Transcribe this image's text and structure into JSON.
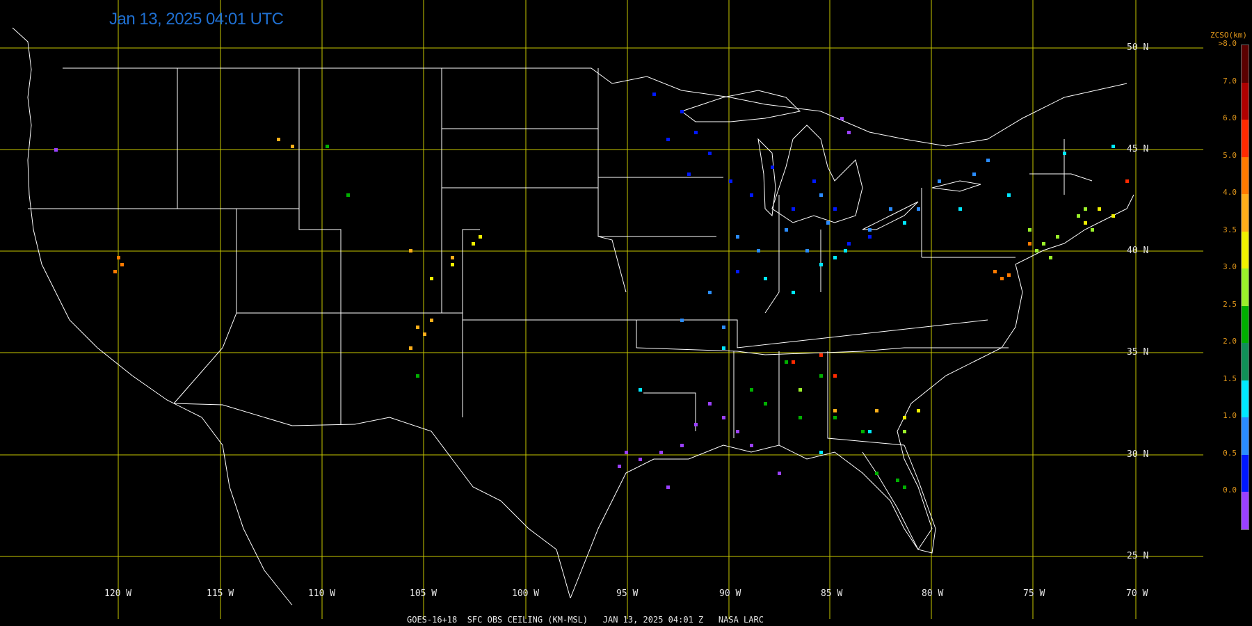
{
  "title": "Jan 13, 2025 04:01 UTC",
  "caption": "GOES-16+18  SFC OBS CEILING (KM-MSL)   JAN 13, 2025 04:01 Z   NASA LARC",
  "lat_lines": [
    {
      "label": "50 N"
    },
    {
      "label": "45 N"
    },
    {
      "label": "40 N"
    },
    {
      "label": "35 N"
    },
    {
      "label": "30 N"
    },
    {
      "label": "25 N"
    }
  ],
  "lon_lines": [
    {
      "label": "120 W"
    },
    {
      "label": "115 W"
    },
    {
      "label": "110 W"
    },
    {
      "label": "105 W"
    },
    {
      "label": "100 W"
    },
    {
      "label": "95 W"
    },
    {
      "label": "90 W"
    },
    {
      "label": "85 W"
    },
    {
      "label": "80 W"
    },
    {
      "label": "75 W"
    },
    {
      "label": "70 W"
    }
  ],
  "legend": {
    "title": "ZCSO(km)",
    "top_label": ">8.0",
    "ticks": [
      "7.0",
      "6.0",
      "5.0",
      "4.0",
      "3.5",
      "3.0",
      "2.5",
      "2.0",
      "1.5",
      "1.0",
      "0.5",
      "0.0"
    ],
    "colors": [
      "#5a0000",
      "#b00000",
      "#ff2a00",
      "#ff7a00",
      "#ffae1a",
      "#f0f000",
      "#9af02a",
      "#00b000",
      "#109058",
      "#00e8ff",
      "#2a8cff",
      "#0018ff",
      "#9a40ff"
    ]
  },
  "colors": {
    "grid": "#c8c800",
    "boundary": "#ffffff",
    "background": "#000000"
  },
  "station_groups": [
    {
      "name": "ceiling-0-1km",
      "color": "#0018ff",
      "points": [
        [
          940,
          135
        ],
        [
          980,
          160
        ],
        [
          1000,
          190
        ],
        [
          1020,
          220
        ],
        [
          1050,
          260
        ],
        [
          1080,
          280
        ],
        [
          1110,
          240
        ],
        [
          1140,
          300
        ],
        [
          1170,
          260
        ],
        [
          1200,
          300
        ],
        [
          1220,
          350
        ],
        [
          1060,
          390
        ],
        [
          1250,
          340
        ],
        [
          960,
          200
        ],
        [
          990,
          250
        ]
      ]
    },
    {
      "name": "ceiling-1-1.5km",
      "color": "#2a8cff",
      "points": [
        [
          1130,
          330
        ],
        [
          1160,
          360
        ],
        [
          1190,
          320
        ],
        [
          1250,
          330
        ],
        [
          1280,
          300
        ],
        [
          1320,
          300
        ],
        [
          1350,
          260
        ],
        [
          1400,
          250
        ],
        [
          1420,
          230
        ],
        [
          1060,
          340
        ],
        [
          1090,
          360
        ],
        [
          1020,
          420
        ],
        [
          980,
          460
        ],
        [
          1040,
          470
        ],
        [
          1180,
          280
        ]
      ]
    },
    {
      "name": "ceiling-1.5-2km",
      "color": "#00e8ff",
      "points": [
        [
          1100,
          400
        ],
        [
          1140,
          420
        ],
        [
          1180,
          380
        ],
        [
          1200,
          370
        ],
        [
          1215,
          360
        ],
        [
          1380,
          300
        ],
        [
          1450,
          280
        ],
        [
          1530,
          220
        ],
        [
          1600,
          210
        ],
        [
          1040,
          500
        ],
        [
          920,
          560
        ],
        [
          1180,
          650
        ],
        [
          1250,
          620
        ],
        [
          1300,
          320
        ]
      ]
    },
    {
      "name": "ceiling-2-3km",
      "color": "#00b000",
      "points": [
        [
          1080,
          560
        ],
        [
          1100,
          580
        ],
        [
          1150,
          600
        ],
        [
          1200,
          600
        ],
        [
          1240,
          620
        ],
        [
          1260,
          680
        ],
        [
          1290,
          690
        ],
        [
          1300,
          700
        ],
        [
          1130,
          520
        ],
        [
          1180,
          540
        ],
        [
          600,
          540
        ],
        [
          470,
          210
        ],
        [
          500,
          280
        ]
      ]
    },
    {
      "name": "ceiling-3-3.5km",
      "color": "#9af02a",
      "points": [
        [
          1480,
          330
        ],
        [
          1490,
          360
        ],
        [
          1500,
          350
        ],
        [
          1510,
          370
        ],
        [
          1520,
          340
        ],
        [
          1550,
          310
        ],
        [
          1560,
          300
        ],
        [
          1570,
          330
        ],
        [
          1150,
          560
        ],
        [
          1300,
          620
        ]
      ]
    },
    {
      "name": "ceiling-3.5-4km",
      "color": "#f0f000",
      "points": [
        [
          650,
          380
        ],
        [
          620,
          400
        ],
        [
          680,
          350
        ],
        [
          690,
          340
        ],
        [
          1580,
          300
        ],
        [
          1600,
          310
        ],
        [
          1560,
          320
        ],
        [
          1300,
          600
        ],
        [
          1320,
          590
        ]
      ]
    },
    {
      "name": "ceiling-4-5km",
      "color": "#ffae1a",
      "points": [
        [
          620,
          460
        ],
        [
          600,
          470
        ],
        [
          590,
          500
        ],
        [
          610,
          480
        ],
        [
          590,
          360
        ],
        [
          650,
          370
        ],
        [
          1200,
          590
        ],
        [
          1260,
          590
        ],
        [
          400,
          200
        ],
        [
          420,
          210
        ]
      ]
    },
    {
      "name": "ceiling-5-6km",
      "color": "#ff7a00",
      "points": [
        [
          170,
          370
        ],
        [
          175,
          380
        ],
        [
          165,
          390
        ],
        [
          1430,
          390
        ],
        [
          1440,
          400
        ],
        [
          1450,
          395
        ],
        [
          1480,
          350
        ]
      ]
    },
    {
      "name": "ceiling-6-7km",
      "color": "#ff2a00",
      "points": [
        [
          1140,
          520
        ],
        [
          1200,
          540
        ],
        [
          1180,
          510
        ],
        [
          1620,
          260
        ]
      ]
    },
    {
      "name": "ceiling-below-0.5km",
      "color": "#9a40ff",
      "points": [
        [
          900,
          650
        ],
        [
          920,
          660
        ],
        [
          950,
          650
        ],
        [
          980,
          640
        ],
        [
          1000,
          610
        ],
        [
          1020,
          580
        ],
        [
          1040,
          600
        ],
        [
          1060,
          620
        ],
        [
          1080,
          640
        ],
        [
          1120,
          680
        ],
        [
          960,
          700
        ],
        [
          890,
          670
        ],
        [
          1210,
          170
        ],
        [
          1220,
          190
        ],
        [
          80,
          215
        ]
      ]
    }
  ]
}
